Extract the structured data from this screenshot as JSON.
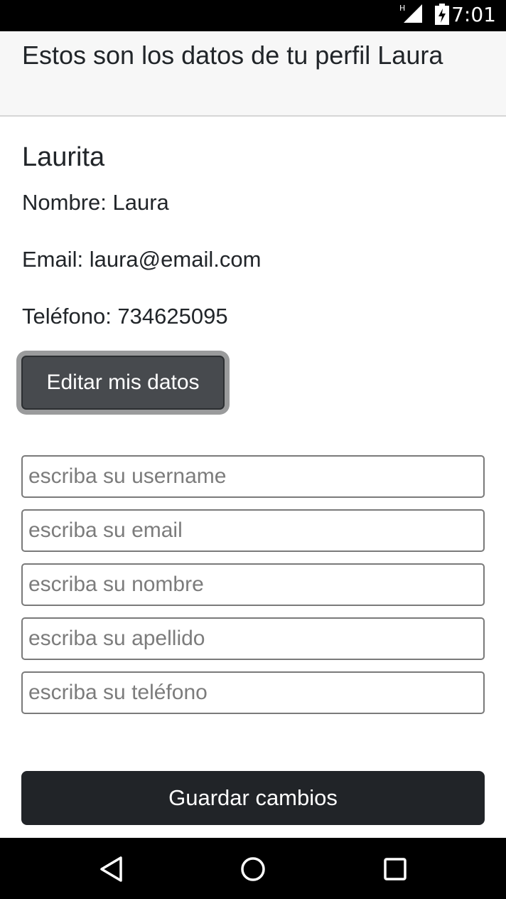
{
  "status_bar": {
    "time": "7:01",
    "network_type": "H",
    "icons": [
      "signal-icon",
      "battery-charging-icon"
    ]
  },
  "header": {
    "title": "Estos son los datos de tu perfil Laura"
  },
  "profile": {
    "username": "Laurita",
    "name_line": "Nombre: Laura",
    "email_line": "Email: laura@email.com",
    "phone_line": "Teléfono: 734625095"
  },
  "buttons": {
    "edit_label": "Editar mis datos",
    "save_label": "Guardar cambios"
  },
  "form": {
    "username_placeholder": "escriba su username",
    "email_placeholder": "escriba su email",
    "nombre_placeholder": "escriba su nombre",
    "apellido_placeholder": "escriba su apellido",
    "telefono_placeholder": "escriba su teléfono"
  },
  "nav_bar": {
    "icons": [
      "back-icon",
      "home-icon",
      "recents-icon"
    ]
  },
  "colors": {
    "status_bar_bg": "#000000",
    "header_bg": "#f7f7f7",
    "edit_button_bg": "#474a4e",
    "save_button_bg": "#212428",
    "text": "#212529"
  }
}
